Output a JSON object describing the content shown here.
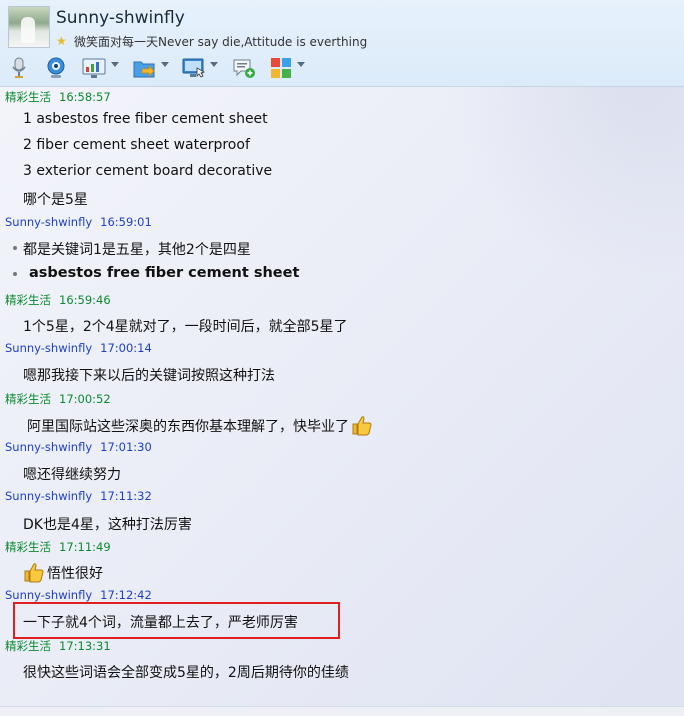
{
  "header": {
    "name": "Sunny-shwinfly",
    "signature": "微笑面对每一天Never say die,Attitude is everthing"
  },
  "toolbar": {
    "buttons": [
      "microphone-icon",
      "webcam-icon",
      "screen-share-icon",
      "file-transfer-icon",
      "remote-desktop-icon",
      "add-chat-icon",
      "apps-icon"
    ]
  },
  "colors": {
    "sender_self": "#0a8a2e",
    "sender_other": "#1f40c8",
    "highlight": "#e02020"
  },
  "messages": [
    {
      "sender": "精彩生活",
      "time": "16:58:57",
      "lines": [
        "1 asbestos free fiber cement sheet",
        "2 fiber cement sheet waterproof",
        "3 exterior cement board decorative",
        "哪个是5星"
      ]
    },
    {
      "sender": "Sunny-shwinfly",
      "time": "16:59:01",
      "lines": [
        "都是关键词1是五星，其他2个是四星",
        "asbestos free fiber cement sheet"
      ]
    },
    {
      "sender": "精彩生活",
      "time": "16:59:46",
      "lines": [
        "1个5星，2个4星就对了，一段时间后，就全部5星了"
      ]
    },
    {
      "sender": "Sunny-shwinfly",
      "time": "17:00:14",
      "lines": [
        "嗯那我接下来以后的关键词按照这种打法"
      ]
    },
    {
      "sender": "精彩生活",
      "time": "17:00:52",
      "lines": [
        "阿里国际站这些深奥的东西你基本理解了，快毕业了"
      ]
    },
    {
      "sender": "Sunny-shwinfly",
      "time": "17:01:30",
      "lines": [
        "嗯还得继续努力"
      ]
    },
    {
      "sender": "Sunny-shwinfly",
      "time": "17:11:32",
      "lines": [
        "DK也是4星，这种打法厉害"
      ]
    },
    {
      "sender": "精彩生活",
      "time": "17:11:49",
      "lines": [
        "悟性很好"
      ]
    },
    {
      "sender": "Sunny-shwinfly",
      "time": "17:12:42",
      "lines": [
        "一下子就4个词，流量都上去了，严老师厉害"
      ]
    },
    {
      "sender": "精彩生活",
      "time": "17:13:31",
      "lines": [
        "很快这些词语会全部变成5星的，2周后期待你的佳绩"
      ]
    }
  ]
}
